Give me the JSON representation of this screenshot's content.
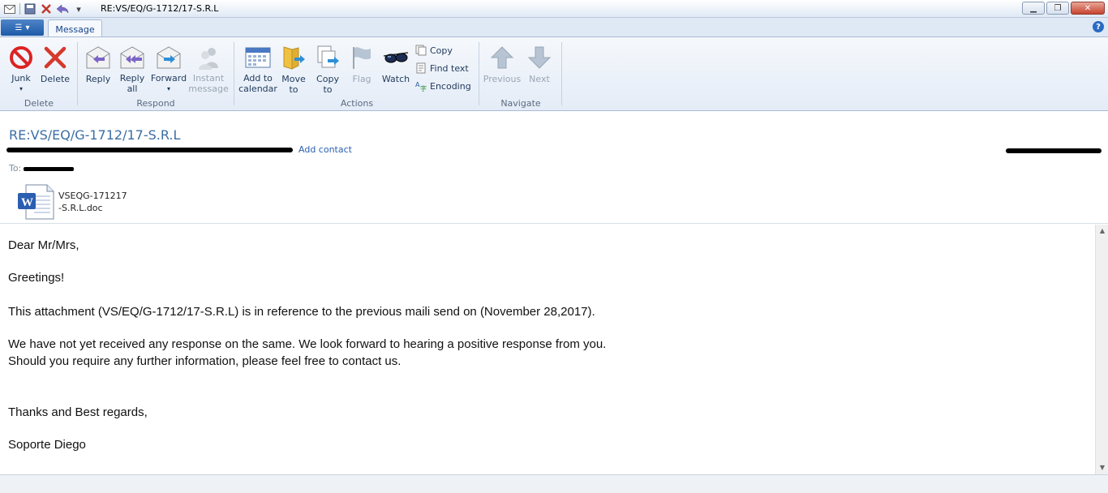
{
  "window": {
    "title": "RE:VS/EQ/G-1712/17-S.R.L",
    "minimize": "▁",
    "maximize": "❐",
    "close": "✕"
  },
  "tabs": {
    "message": "Message",
    "help": "?"
  },
  "ribbon": {
    "groups": {
      "delete": "Delete",
      "respond": "Respond",
      "actions": "Actions",
      "navigate": "Navigate"
    },
    "buttons": {
      "junk": "Junk",
      "delete": "Delete",
      "reply": "Reply",
      "reply_all_1": "Reply",
      "reply_all_2": "all",
      "forward": "Forward",
      "instant_1": "Instant",
      "instant_2": "message",
      "add_cal_1": "Add to",
      "add_cal_2": "calendar",
      "move_1": "Move",
      "move_2": "to",
      "copyto_1": "Copy",
      "copyto_2": "to",
      "flag": "Flag",
      "watch": "Watch",
      "copy": "Copy",
      "find_text": "Find text",
      "encoding": "Encoding",
      "previous": "Previous",
      "next": "Next"
    }
  },
  "header": {
    "subject": "RE:VS/EQ/G-1712/17-S.R.L",
    "add_contact": "Add contact",
    "to_label": "To:",
    "attachment_line1": "VSEQG-171217",
    "attachment_line2": "-S.R.L.doc"
  },
  "body": {
    "l1": "Dear Mr/Mrs,",
    "l2": "Greetings!",
    "l3": "This attachment  (VS/EQ/G-1712/17-S.R.L) is in reference to the previous maili send  on (November 28,2017).",
    "l4": "We have not yet received any response on the same. We look forward to hearing a positive response from you.",
    "l5": "Should you require any further information, please feel free to contact us.",
    "l6": "Thanks and Best regards,",
    "l7": "Soporte Diego"
  },
  "colors": {
    "accent": "#3b6ea5",
    "ribbon_text": "#1e395b"
  }
}
